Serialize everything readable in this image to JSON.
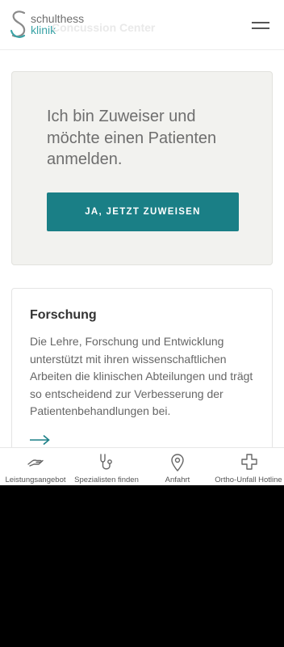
{
  "header": {
    "logo_line1": "schulthess",
    "logo_line2": "klinik",
    "page_title_ghost": "Concussion Center",
    "menu_icon": "hamburger-icon"
  },
  "referral": {
    "heading": "Ich bin Zuweiser und möchte einen Patienten anmelden.",
    "button_label": "JA, JETZT ZUWEISEN"
  },
  "research": {
    "title": "Forschung",
    "body": "Die Lehre, Forschung und Entwicklung unterstützt mit ihren wissenschaftlichen Arbeiten die klinischen Abteilungen und trägt so entscheidend zur Verbesserung der Patientenbehandlungen bei.",
    "link_icon": "arrow-right-icon"
  },
  "bottom_nav": {
    "items": [
      {
        "label": "Leistungsangebot",
        "icon": "hand-icon"
      },
      {
        "label": "Spezialisten finden",
        "icon": "stethoscope-icon"
      },
      {
        "label": "Anfahrt",
        "icon": "location-pin-icon"
      },
      {
        "label": "Ortho-Unfall Hotline",
        "icon": "medical-cross-icon"
      }
    ]
  },
  "colors": {
    "brand_teal": "#1a7f86",
    "logo_teal": "#3aa3a6",
    "card_bg": "#f2f2ef",
    "text_gray": "#6e6e6e"
  }
}
